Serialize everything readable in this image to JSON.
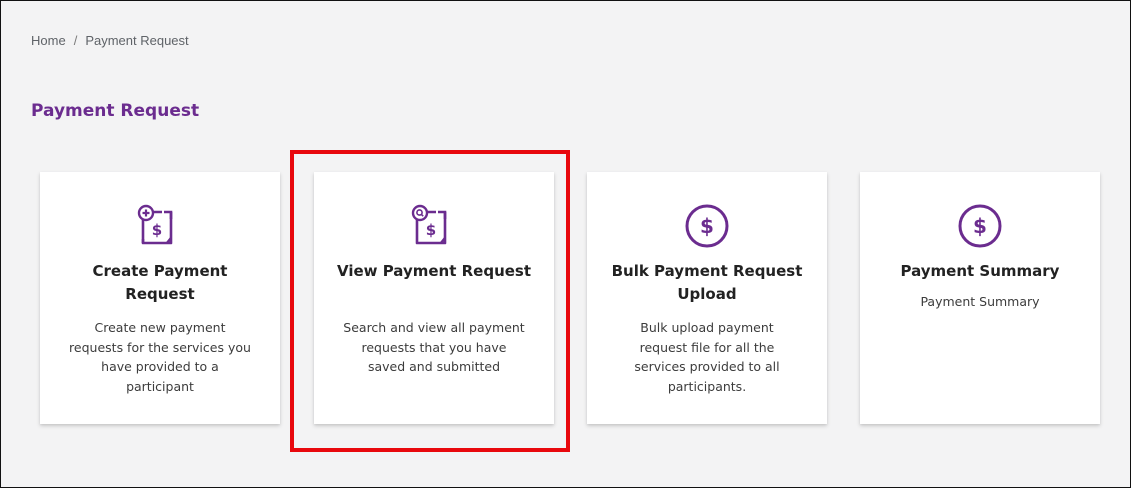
{
  "breadcrumb": {
    "home": "Home",
    "separator": "/",
    "current": "Payment Request"
  },
  "page_title": "Payment Request",
  "colors": {
    "brand_purple": "#6b2c8f",
    "highlight_red": "#e8080d"
  },
  "cards": [
    {
      "icon": "document-add-dollar-icon",
      "title": "Create Payment Request",
      "description": "Create new payment requests for the services you have provided to a participant"
    },
    {
      "icon": "document-search-dollar-icon",
      "title": "View Payment Request",
      "description": "Search and view all payment requests that you have saved and submitted"
    },
    {
      "icon": "dollar-circle-icon",
      "title": "Bulk Payment Request Upload",
      "description": "Bulk upload payment request file for all the services provided to all participants."
    },
    {
      "icon": "dollar-circle-icon",
      "title": "Payment Summary",
      "description": "Payment Summary"
    }
  ]
}
